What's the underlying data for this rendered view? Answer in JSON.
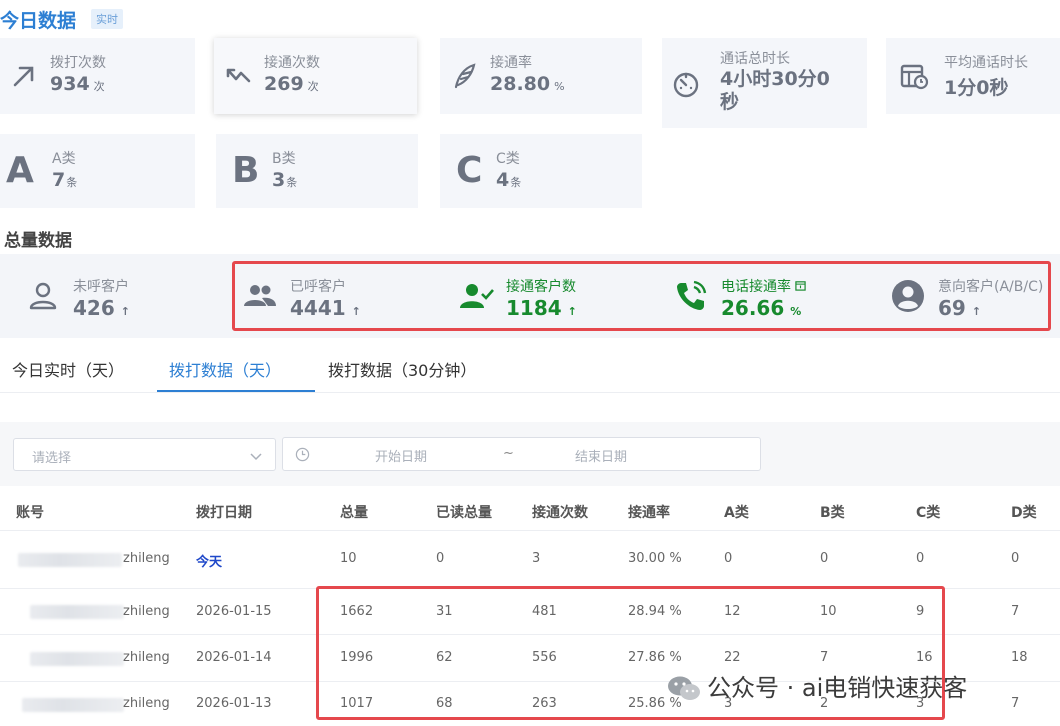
{
  "today": {
    "title": "今日数据",
    "badge": "实时",
    "stats": [
      {
        "label": "拨打次数",
        "value": "934",
        "unit": "次",
        "icon": "arrow-up-right-icon"
      },
      {
        "label": "接通次数",
        "value": "269",
        "unit": "次",
        "icon": "connect-arrow-icon"
      },
      {
        "label": "接通率",
        "value": "28.80",
        "unit": "%",
        "icon": "feather-icon"
      },
      {
        "label": "通话总时长",
        "value_line1": "4小时30分0",
        "value_line2": "秒",
        "icon": "timer-icon"
      },
      {
        "label": "平均通话时长",
        "value": "1分0秒",
        "icon": "stopwatch-table-icon"
      }
    ],
    "categories": [
      {
        "letter": "A",
        "label": "A类",
        "value": "7",
        "unit": "条"
      },
      {
        "letter": "B",
        "label": "B类",
        "value": "3",
        "unit": "条"
      },
      {
        "letter": "C",
        "label": "C类",
        "value": "4",
        "unit": "条"
      }
    ]
  },
  "total": {
    "title": "总量数据",
    "stats": [
      {
        "label": "未呼客户",
        "value": "426",
        "trend": "↑",
        "icon": "person-outline-icon"
      },
      {
        "label": "已呼客户",
        "value": "4441",
        "trend": "↑",
        "icon": "group-icon"
      },
      {
        "label": "接通客户数",
        "value": "1184",
        "trend": "↑",
        "icon": "person-check-icon"
      },
      {
        "label": "电话接通率",
        "value": "26.66",
        "unit": "%",
        "icon": "phone-ringing-icon"
      },
      {
        "label": "意向客户(A/B/C)",
        "value": "69",
        "trend": "↑",
        "icon": "account-circle-icon"
      }
    ]
  },
  "tabs": [
    {
      "label": "今日实时（天）",
      "active": false
    },
    {
      "label": "拨打数据（天）",
      "active": true
    },
    {
      "label": "拨打数据（30分钟）",
      "active": false
    }
  ],
  "filters": {
    "select_placeholder": "请选择",
    "start_placeholder": "开始日期",
    "separator": "~",
    "end_placeholder": "结束日期"
  },
  "table": {
    "headers": [
      "账号",
      "拨打日期",
      "总量",
      "已读总量",
      "接通次数",
      "接通率",
      "A类",
      "B类",
      "C类",
      "D类"
    ],
    "rows": [
      {
        "account": "zhileng",
        "date": "今天",
        "total": "10",
        "read": "0",
        "connected": "3",
        "rate": "30.00 %",
        "a": "0",
        "b": "0",
        "c": "0",
        "d": "0"
      },
      {
        "account": "zhileng",
        "date": "2026-01-15",
        "total": "1662",
        "read": "31",
        "connected": "481",
        "rate": "28.94 %",
        "a": "12",
        "b": "10",
        "c": "9",
        "d": "7"
      },
      {
        "account": "zhileng",
        "date": "2026-01-14",
        "total": "1996",
        "read": "62",
        "connected": "556",
        "rate": "27.86 %",
        "a": "22",
        "b": "7",
        "c": "16",
        "d": "18"
      },
      {
        "account": "zhileng",
        "date": "2026-01-13",
        "total": "1017",
        "read": "68",
        "connected": "263",
        "rate": "25.86 %",
        "a": "3",
        "b": "2",
        "c": "3",
        "d": "7"
      }
    ]
  },
  "watermark": "公众号 · ai电销快速获客",
  "colors": {
    "accent": "#2d7fd3",
    "green": "#178a2e",
    "highlight": "#e5484d"
  }
}
